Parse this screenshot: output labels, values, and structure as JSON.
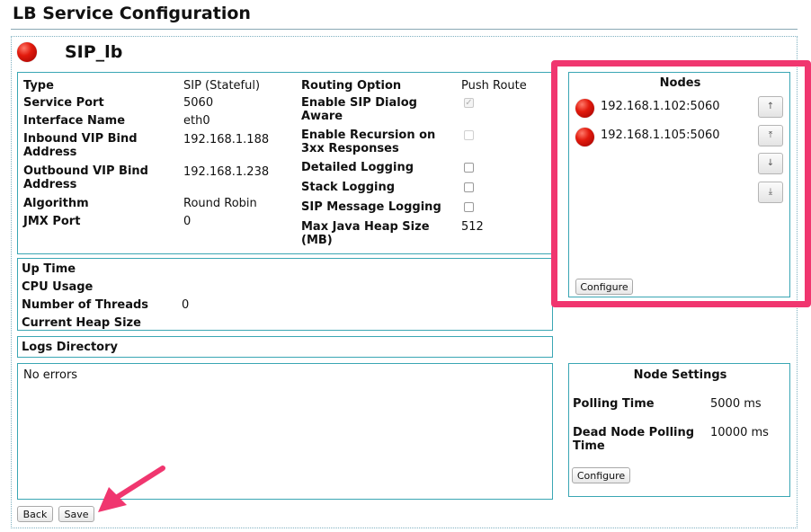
{
  "page": {
    "title": "LB Service Configuration"
  },
  "service": {
    "name": "SIP_lb",
    "status_color": "#d6120a",
    "left_fields": [
      {
        "label": "Type",
        "value": "SIP (Stateful)"
      },
      {
        "label": "Service Port",
        "value": "5060"
      },
      {
        "label": "Interface Name",
        "value": "eth0"
      },
      {
        "label": "Inbound VIP Bind Address",
        "value": "192.168.1.188"
      },
      {
        "label": "Outbound VIP Bind Address",
        "value": "192.168.1.238"
      },
      {
        "label": "Algorithm",
        "value": "Round Robin"
      },
      {
        "label": "JMX Port",
        "value": "0"
      }
    ],
    "routing_option": {
      "label": "Routing Option",
      "value": "Push Route"
    },
    "sip_dialog_aware": {
      "label": "Enable SIP Dialog Aware",
      "checked": true,
      "disabled": true
    },
    "recursion_3xx": {
      "label": "Enable Recursion on 3xx Responses",
      "checked": false,
      "disabled": true
    },
    "detailed_logging": {
      "label": "Detailed Logging",
      "checked": false
    },
    "stack_logging": {
      "label": "Stack Logging",
      "checked": false
    },
    "sip_message_logging": {
      "label": "SIP Message Logging",
      "checked": false
    },
    "max_heap": {
      "label": "Max Java Heap Size (MB)",
      "value": "512"
    }
  },
  "stats": {
    "up_time": {
      "label": "Up Time",
      "value": ""
    },
    "cpu_usage": {
      "label": "CPU Usage",
      "value": ""
    },
    "threads": {
      "label": "Number of Threads",
      "value": "0"
    },
    "heap": {
      "label": "Current Heap Size",
      "value": ""
    }
  },
  "logs": {
    "label": "Logs Directory",
    "errors_text": "No errors"
  },
  "nodes": {
    "title": "Nodes",
    "items": [
      {
        "address": "192.168.1.102:5060",
        "status_color": "#d6120a"
      },
      {
        "address": "192.168.1.105:5060",
        "status_color": "#d6120a"
      }
    ],
    "move_buttons": {
      "up": "↑",
      "top": "⤒",
      "down": "↓",
      "bottom": "⤓"
    },
    "configure_label": "Configure"
  },
  "node_settings": {
    "title": "Node Settings",
    "polling_time": {
      "label": "Polling Time",
      "value": "5000 ms"
    },
    "dead_node_polling_time": {
      "label": "Dead Node Polling Time",
      "value": "10000 ms"
    },
    "configure_label": "Configure"
  },
  "actions": {
    "back_label": "Back",
    "save_label": "Save"
  },
  "annotations": {
    "highlight_color": "#f0366f",
    "arrow_color": "#f0366f"
  }
}
